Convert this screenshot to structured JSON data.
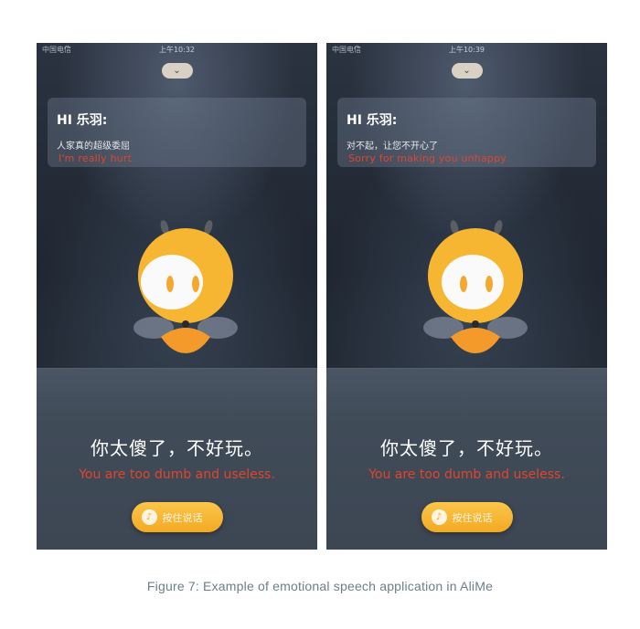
{
  "panels": [
    {
      "status": {
        "carrier": "中国电信",
        "wifi_icon": "wifi-icon",
        "time": "上午10:32"
      },
      "collapse_icon": "chevron-down-icon",
      "card": {
        "greeting": "HI 乐羽:",
        "message": "人家真的超级委屈",
        "translation": "I'm really hurt"
      },
      "speech": {
        "text": "你太傻了，不好玩。",
        "translation": "You are too dumb and useless."
      },
      "button": {
        "icon": "microphone-icon",
        "label": "按住说话"
      }
    },
    {
      "status": {
        "carrier": "中国电信",
        "wifi_icon": "wifi-icon",
        "time": "上午10:39"
      },
      "collapse_icon": "chevron-down-icon",
      "card": {
        "greeting": "HI 乐羽:",
        "message": "对不起，让您不开心了",
        "translation": "Sorry for making you unhappy"
      },
      "speech": {
        "text": "你太傻了，不好玩。",
        "translation": "You are too dumb and useless."
      },
      "button": {
        "icon": "microphone-icon",
        "label": "按住说话"
      }
    }
  ],
  "caption": "Figure 7: Example of emotional speech application in AliMe",
  "colors": {
    "accent": "#f4a923",
    "translation_red": "#e0452c",
    "background": "#1f2631"
  }
}
